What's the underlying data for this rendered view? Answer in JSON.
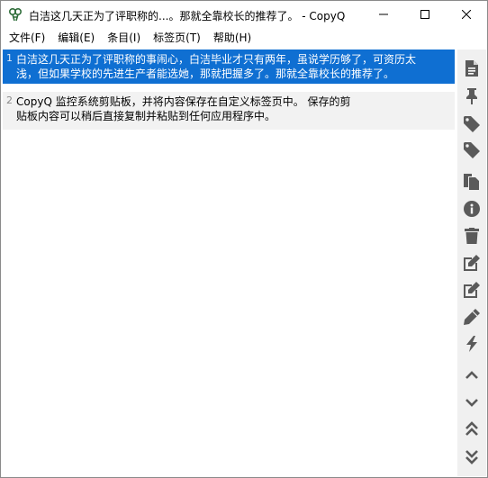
{
  "window": {
    "title": "白洁这几天正为了评职称的...。那就全靠校长的推荐了。 - CopyQ",
    "app_icon": "copyq-icon",
    "controls": [
      "minimize-icon",
      "maximize-icon",
      "close-icon"
    ]
  },
  "menu": {
    "items": [
      "文件(F)",
      "编辑(E)",
      "条目(I)",
      "标签页(T)",
      "帮助(H)"
    ]
  },
  "list": {
    "items": [
      {
        "number": "1",
        "text": "白洁这几天正为了评职称的事闹心，白洁毕业才只有两年，虽说学历够了，可资历太\n浅，但如果学校的先进生产者能选她，那就把握多了。那就全靠校长的推荐了。",
        "selected": true
      },
      {
        "number": "2",
        "text": "CopyQ 监控系统剪贴板，并将内容保存在自定义标签页中。 保存的剪\n贴板内容可以稍后直接复制并粘贴到任何应用程序中。",
        "selected": false
      }
    ]
  },
  "toolbar": {
    "icons": [
      "new-item-icon",
      "pin-icon",
      "tag-icon",
      "tag-icon",
      "copy-icon",
      "info-icon",
      "trash-icon",
      "edit-icon",
      "edit-external-icon",
      "pencil-icon",
      "bolt-icon",
      "move-up-icon",
      "move-down-icon",
      "move-top-icon",
      "move-bottom-icon"
    ],
    "icon_color": "#5a5a5a"
  },
  "colors": {
    "selection": "#0f6fd2",
    "alt_row": "#f2f2f2",
    "toolbar_bg": "#f0f0f0"
  }
}
